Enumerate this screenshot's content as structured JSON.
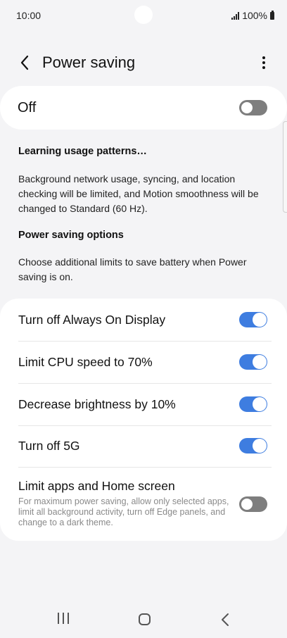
{
  "status_bar": {
    "time": "10:00",
    "battery_text": "100%",
    "icons": [
      "signal-icon",
      "battery-icon"
    ]
  },
  "app_bar": {
    "title": "Power saving",
    "back_icon": "chevron-left-icon",
    "more_icon": "more-vert-icon"
  },
  "master_switch": {
    "label": "Off",
    "state": "off"
  },
  "sections": {
    "learning": {
      "heading": "Learning usage patterns…",
      "text": "Background network usage, syncing, and location checking will be limited, and Motion smoothness will be changed to Standard (60 Hz)."
    },
    "options": {
      "heading": "Power saving options",
      "text": "Choose additional limits to save battery when Power saving is on."
    }
  },
  "options_list": [
    {
      "label": "Turn off Always On Display",
      "state": "on"
    },
    {
      "label": "Limit CPU speed to 70%",
      "state": "on"
    },
    {
      "label": "Decrease brightness by 10%",
      "state": "on"
    },
    {
      "label": "Turn off 5G",
      "state": "on"
    },
    {
      "label": "Limit apps and Home screen",
      "subtitle": "For maximum power saving, allow only selected apps, limit all background activity, turn off Edge panels, and change to a dark theme.",
      "state": "off"
    }
  ],
  "colors": {
    "accent": "#3e7de0",
    "toggle_off": "#7e7e7e",
    "background": "#f4f4f6",
    "card": "#ffffff"
  },
  "nav_bar": {
    "icons": [
      "recents-icon",
      "home-icon",
      "back-icon"
    ]
  }
}
